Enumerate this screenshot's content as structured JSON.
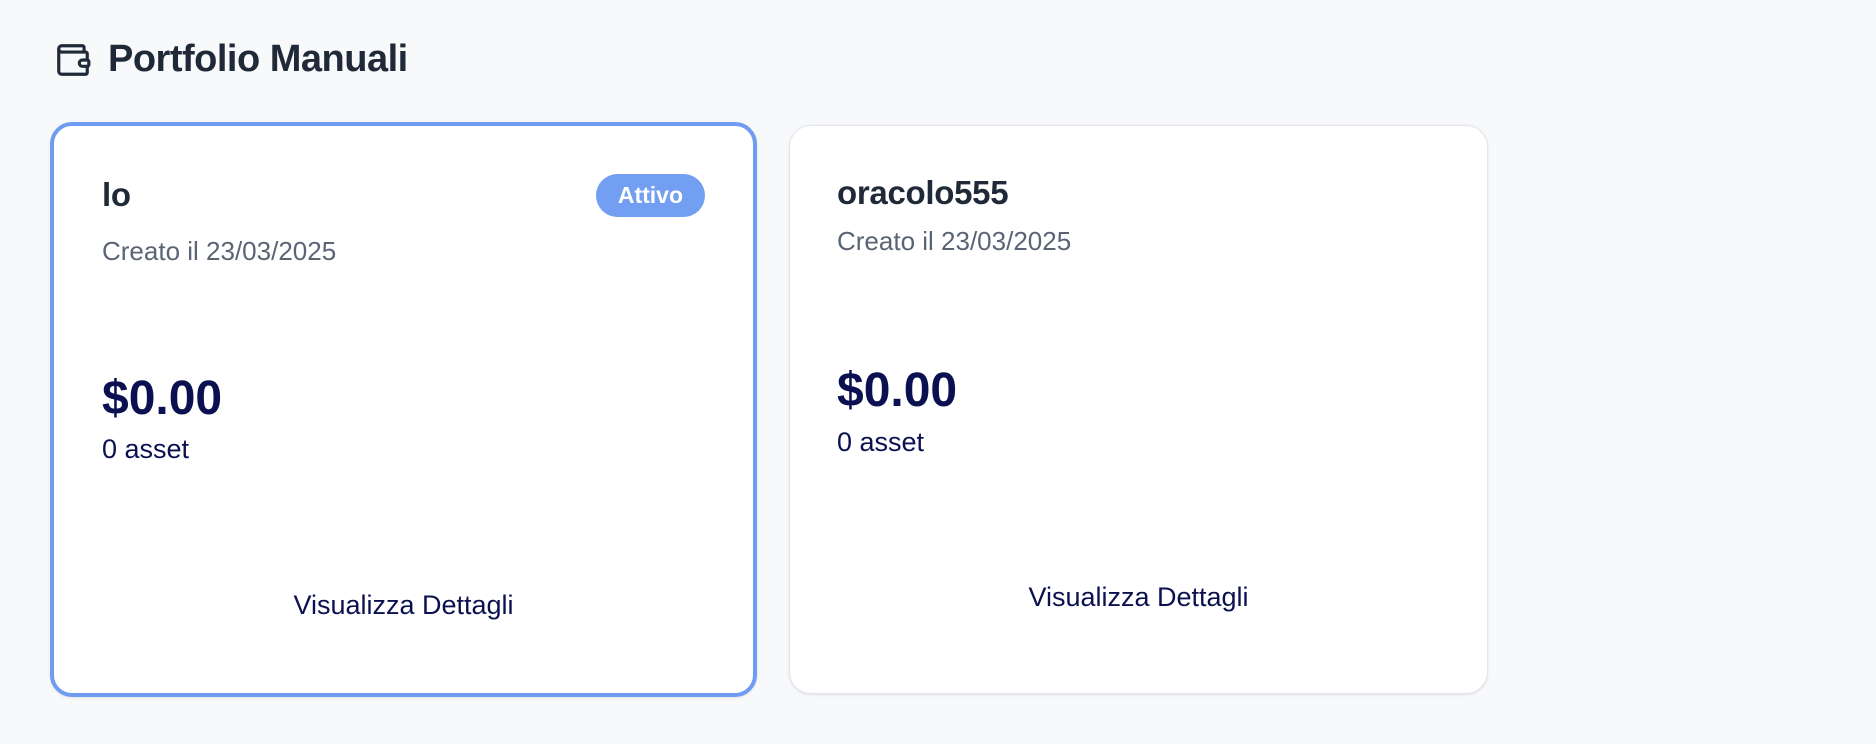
{
  "header": {
    "icon": "wallet-icon",
    "title": "Portfolio Manuali"
  },
  "portfolios": [
    {
      "name": "lo",
      "created": "Creato il 23/03/2025",
      "value": "$0.00",
      "assets": "0 asset",
      "details_label": "Visualizza Dettagli",
      "badge": "Attivo",
      "active": true
    },
    {
      "name": "oracolo555",
      "created": "Creato il 23/03/2025",
      "value": "$0.00",
      "assets": "0 asset",
      "details_label": "Visualizza Dettagli",
      "active": false
    }
  ],
  "colors": {
    "accent": "#739ff2",
    "active_border": "#6f9cf0",
    "value_text": "#0b1150",
    "background": "#f8f9fb"
  }
}
